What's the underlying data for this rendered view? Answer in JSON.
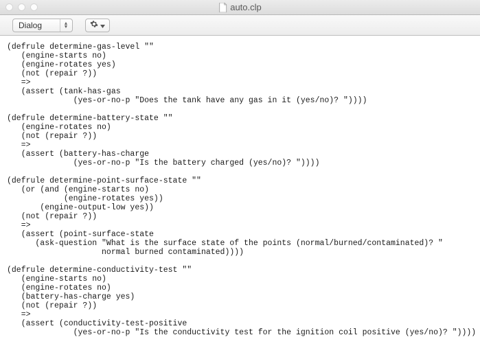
{
  "window": {
    "title": "auto.clp"
  },
  "toolbar": {
    "dropdown_label": "Dialog"
  },
  "editor": {
    "content": "(defrule determine-gas-level \"\"\n   (engine-starts no)\n   (engine-rotates yes)\n   (not (repair ?))\n   =>\n   (assert (tank-has-gas\n              (yes-or-no-p \"Does the tank have any gas in it (yes/no)? \"))))\n\n(defrule determine-battery-state \"\"\n   (engine-rotates no)\n   (not (repair ?))\n   =>\n   (assert (battery-has-charge\n              (yes-or-no-p \"Is the battery charged (yes/no)? \"))))\n\n(defrule determine-point-surface-state \"\"\n   (or (and (engine-starts no)\n            (engine-rotates yes))\n       (engine-output-low yes))\n   (not (repair ?))\n   =>\n   (assert (point-surface-state\n      (ask-question \"What is the surface state of the points (normal/burned/contaminated)? \"\n                    normal burned contaminated))))\n\n(defrule determine-conductivity-test \"\"\n   (engine-starts no)\n   (engine-rotates no)\n   (battery-has-charge yes)\n   (not (repair ?))\n   =>\n   (assert (conductivity-test-positive\n              (yes-or-no-p \"Is the conductivity test for the ignition coil positive (yes/no)? \"))))"
  }
}
